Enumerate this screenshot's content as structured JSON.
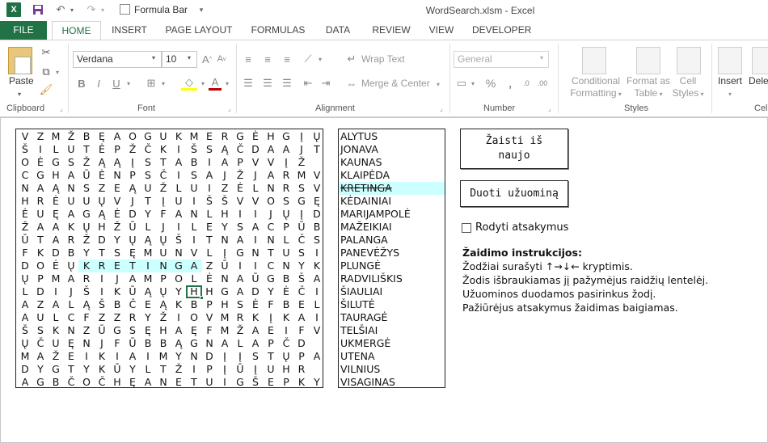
{
  "app": {
    "logo": "X",
    "window_title": "WordSearch.xlsm - Excel",
    "formula_bar_label": "Formula Bar"
  },
  "tabs": [
    "FILE",
    "HOME",
    "INSERT",
    "PAGE LAYOUT",
    "FORMULAS",
    "DATA",
    "REVIEW",
    "VIEW",
    "DEVELOPER"
  ],
  "ribbon": {
    "groups": {
      "clipboard": "Clipboard",
      "font": "Font",
      "alignment": "Alignment",
      "number": "Number",
      "styles": "Styles",
      "cells": "Cel"
    },
    "paste_label": "Paste",
    "font_name": "Verdana",
    "font_size": "10",
    "wrap_text": "Wrap Text",
    "merge_center": "Merge & Center",
    "number_format": "General",
    "conditional_formatting": [
      "Conditional",
      "Formatting"
    ],
    "format_as_table": [
      "Format as",
      "Table"
    ],
    "cell_styles": [
      "Cell",
      "Styles"
    ],
    "insert": "Insert",
    "delete": "Dele"
  },
  "grid_rows": [
    "VZMŽBĘAOGUKMERGĖHGĮŲ",
    "ŠILUTĖPŽČKIŠSĄČDAAJT",
    "OĖGSŽĄĄĮSTABIAPVVĮŽ",
    "CGHAŪĖNPSČISAJŽJARMV",
    "NAĄNSZEĄUŽLUIZĖLNRSV",
    "HRĖUUŲVJTĮUIŠŠVVOSGĘ",
    "ĖUĘAGĄĖDYFANLHIIJŲĮD",
    "ŽAAKŲHŽŪLJILEYSACPŪB",
    "ŪTARŽDYŲĄŲŠITNAINLČS",
    "FKDBYTSĘMUNVLĮGNTUSI",
    "DOĖŲKRETINGAZŪIICNYK",
    "ŲPMARIJAMPOLĖNAŪGBŠA",
    "LDIJŠIKŪĄŲYHHGADYĖČI",
    "AZALĄŠBČEĄKBPHSĖFBEL",
    "AULCFZZRYŽIOVMRKĮKAI",
    "ŠSKNZŪGSĘHAĘFMŽAEIFV",
    "ŲČUĘNJFŪBBĄGNALAPČD",
    "MAŽEIKIAIMYNDĮĮSTŲPA",
    "DYGTYKŪYLTŽIPĮŪĮUHR",
    "AGBČOČHĘANETUIGŠEPKY"
  ],
  "words": [
    "ALYTUS",
    "JONAVA",
    "KAUNAS",
    "KLAIPĖDA",
    "KRETINGA",
    "KĖDAINIAI",
    "MARIJAMPOLĖ",
    "MAŽEIKIAI",
    "PALANGA",
    "PANEVĖŽYS",
    "PLUNGĖ",
    "RADVILIŠKIS",
    "ŠIAULIAI",
    "ŠILUTĖ",
    "TAURAGĖ",
    "TELŠIAI",
    "UKMERGĖ",
    "UTENA",
    "VILNIUS",
    "VISAGINAS"
  ],
  "found_words": [
    "KRETINGA"
  ],
  "found_path": {
    "row": 10,
    "col_start": 4,
    "col_end": 11
  },
  "selected_cell": {
    "row": 12,
    "col": 11
  },
  "buttons": {
    "restart": [
      "Žaisti iš",
      "naujo"
    ],
    "hint": "Duoti užuominą"
  },
  "show_answers": {
    "label": "Rodyti atsakymus",
    "checked": false
  },
  "instructions": {
    "title": "Žaidimo instrukcijos:",
    "lines": [
      "Žodžiai surašyti ↑→↓← kryptimis.",
      "Žodis išbraukiamas jį pažymėjus raidžių lentelėj.",
      "Užuominos duodamos pasirinkus žodį.",
      "Pažiūrėjus atsakymus žaidimas baigiamas."
    ]
  },
  "colors": {
    "excel_green": "#217346",
    "highlight": "#ccffff"
  }
}
